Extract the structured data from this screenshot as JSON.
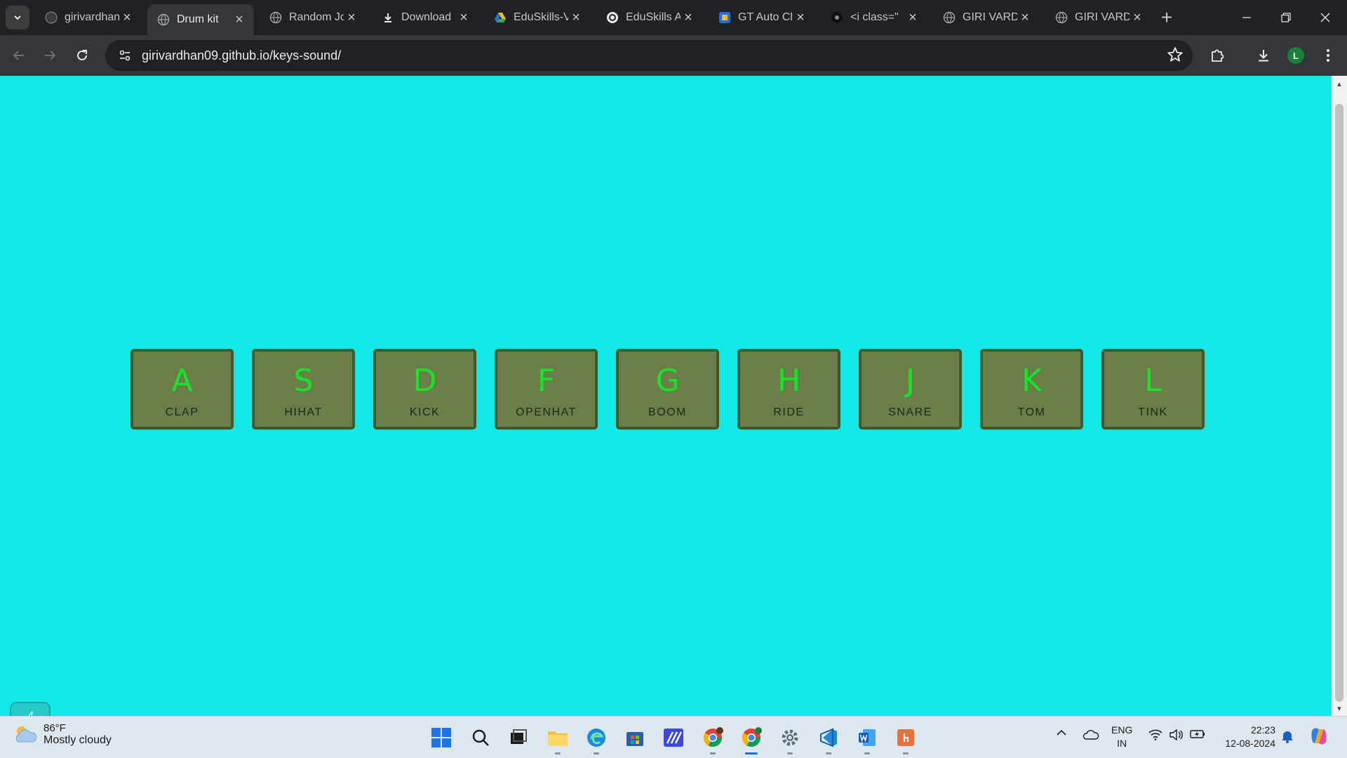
{
  "browser": {
    "tabs": [
      {
        "title": "girivardhan",
        "icon": "github-icon",
        "active": false
      },
      {
        "title": "Drum kit",
        "icon": "globe-icon",
        "active": true
      },
      {
        "title": "Random Jo",
        "icon": "globe-icon",
        "active": false
      },
      {
        "title": "Download",
        "icon": "download-icon",
        "active": false
      },
      {
        "title": "EduSkills-V",
        "icon": "google-drive-icon",
        "active": false
      },
      {
        "title": "EduSkills A",
        "icon": "openai-icon",
        "active": false
      },
      {
        "title": "GT Auto Cl",
        "icon": "gt-auto-icon",
        "active": false
      },
      {
        "title": "<i class=\"",
        "icon": "dark-site-icon",
        "active": false
      },
      {
        "title": "GIRI VARD",
        "icon": "globe-icon",
        "active": false
      },
      {
        "title": "GIRI VARD",
        "icon": "globe-icon",
        "active": false
      }
    ],
    "url": "girivardhan09.github.io/keys-sound/",
    "profile_initial": "L"
  },
  "drum_kit": {
    "keys": [
      {
        "key": "A",
        "sound": "CLAP"
      },
      {
        "key": "S",
        "sound": "HIHAT"
      },
      {
        "key": "D",
        "sound": "KICK"
      },
      {
        "key": "F",
        "sound": "OPENHAT"
      },
      {
        "key": "G",
        "sound": "BOOM"
      },
      {
        "key": "H",
        "sound": "RIDE"
      },
      {
        "key": "J",
        "sound": "SNARE"
      },
      {
        "key": "K",
        "sound": "TOM"
      },
      {
        "key": "L",
        "sound": "TINK"
      }
    ],
    "colors": {
      "background": "#13e8e9",
      "key_fill": "#6b7e4a",
      "key_border": "#3d5a2a",
      "letter": "#13e626"
    }
  },
  "taskbar": {
    "weather_temp": "86°F",
    "weather_condition": "Mostly cloudy",
    "lang_line1": "ENG",
    "lang_line2": "IN",
    "time": "22:23",
    "date": "12-08-2024"
  }
}
